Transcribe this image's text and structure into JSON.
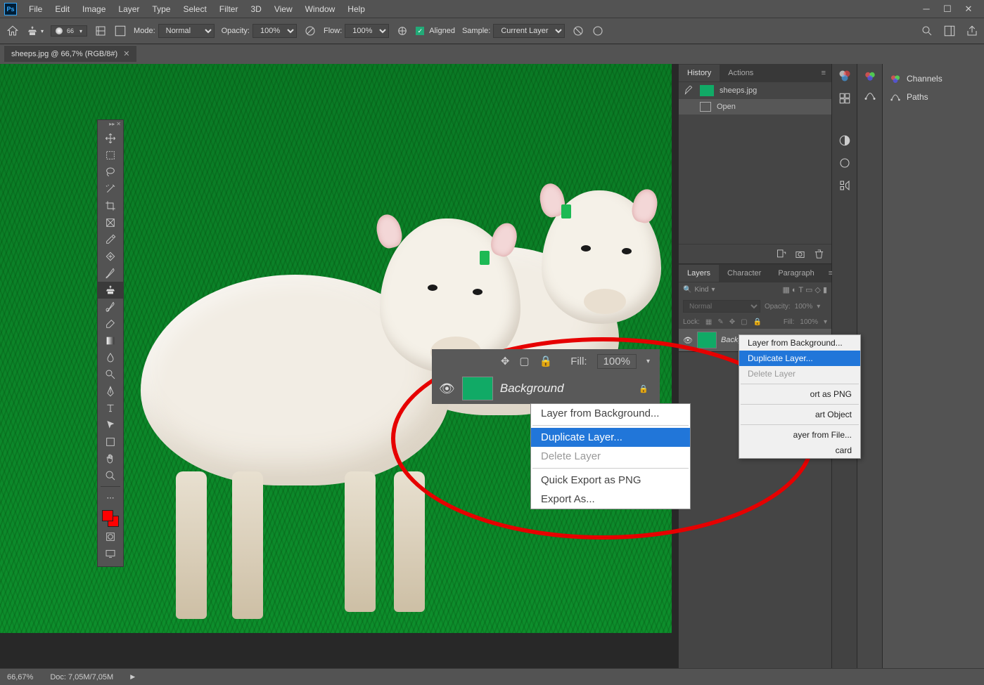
{
  "app": {
    "logo": "Ps"
  },
  "menu": [
    "File",
    "Edit",
    "Image",
    "Layer",
    "Type",
    "Select",
    "Filter",
    "3D",
    "View",
    "Window",
    "Help"
  ],
  "options": {
    "brush_size": "66",
    "mode_label": "Mode:",
    "mode_value": "Normal",
    "opacity_label": "Opacity:",
    "opacity_value": "100%",
    "flow_label": "Flow:",
    "flow_value": "100%",
    "aligned_label": "Aligned",
    "sample_label": "Sample:",
    "sample_value": "Current Layer"
  },
  "document": {
    "tab": "sheeps.jpg @ 66,7% (RGB/8#)"
  },
  "history": {
    "tabs": [
      "History",
      "Actions"
    ],
    "file": "sheeps.jpg",
    "steps": [
      "Open"
    ]
  },
  "layers_panel": {
    "tabs": [
      "Layers",
      "Character",
      "Paragraph"
    ],
    "kind": "Kind",
    "blend": "Normal",
    "opacity_label": "Opacity:",
    "opacity_value": "100%",
    "lock_label": "Lock:",
    "fill_label": "Fill:",
    "fill_value": "100%",
    "layer_name": "Background"
  },
  "side_panels": {
    "channels": "Channels",
    "paths": "Paths"
  },
  "context_menu": {
    "items": [
      {
        "label": "Layer from Background...",
        "state": "normal"
      },
      {
        "label": "Duplicate Layer...",
        "state": "hl"
      },
      {
        "label": "Delete Layer",
        "state": "dis"
      },
      {
        "sep": true
      },
      {
        "label": "Quick Export as PNG",
        "state": "normal",
        "short": "ort as PNG"
      },
      {
        "label": "Export As...",
        "state": "normal"
      },
      {
        "sep": true
      },
      {
        "label": "Convert to Smart Object",
        "state": "normal",
        "short": "art Object"
      },
      {
        "sep": true
      },
      {
        "label": "Replace Layer from File...",
        "state": "normal",
        "short": "ayer from File..."
      },
      {
        "label": "Discard",
        "state": "normal",
        "short": "card"
      }
    ]
  },
  "zoom_row": {
    "fill_label": "Fill:",
    "fill_value": "100%",
    "layer_name": "Background"
  },
  "status": {
    "zoom": "66,67%",
    "doc": "Doc: 7,05M/7,05M"
  }
}
